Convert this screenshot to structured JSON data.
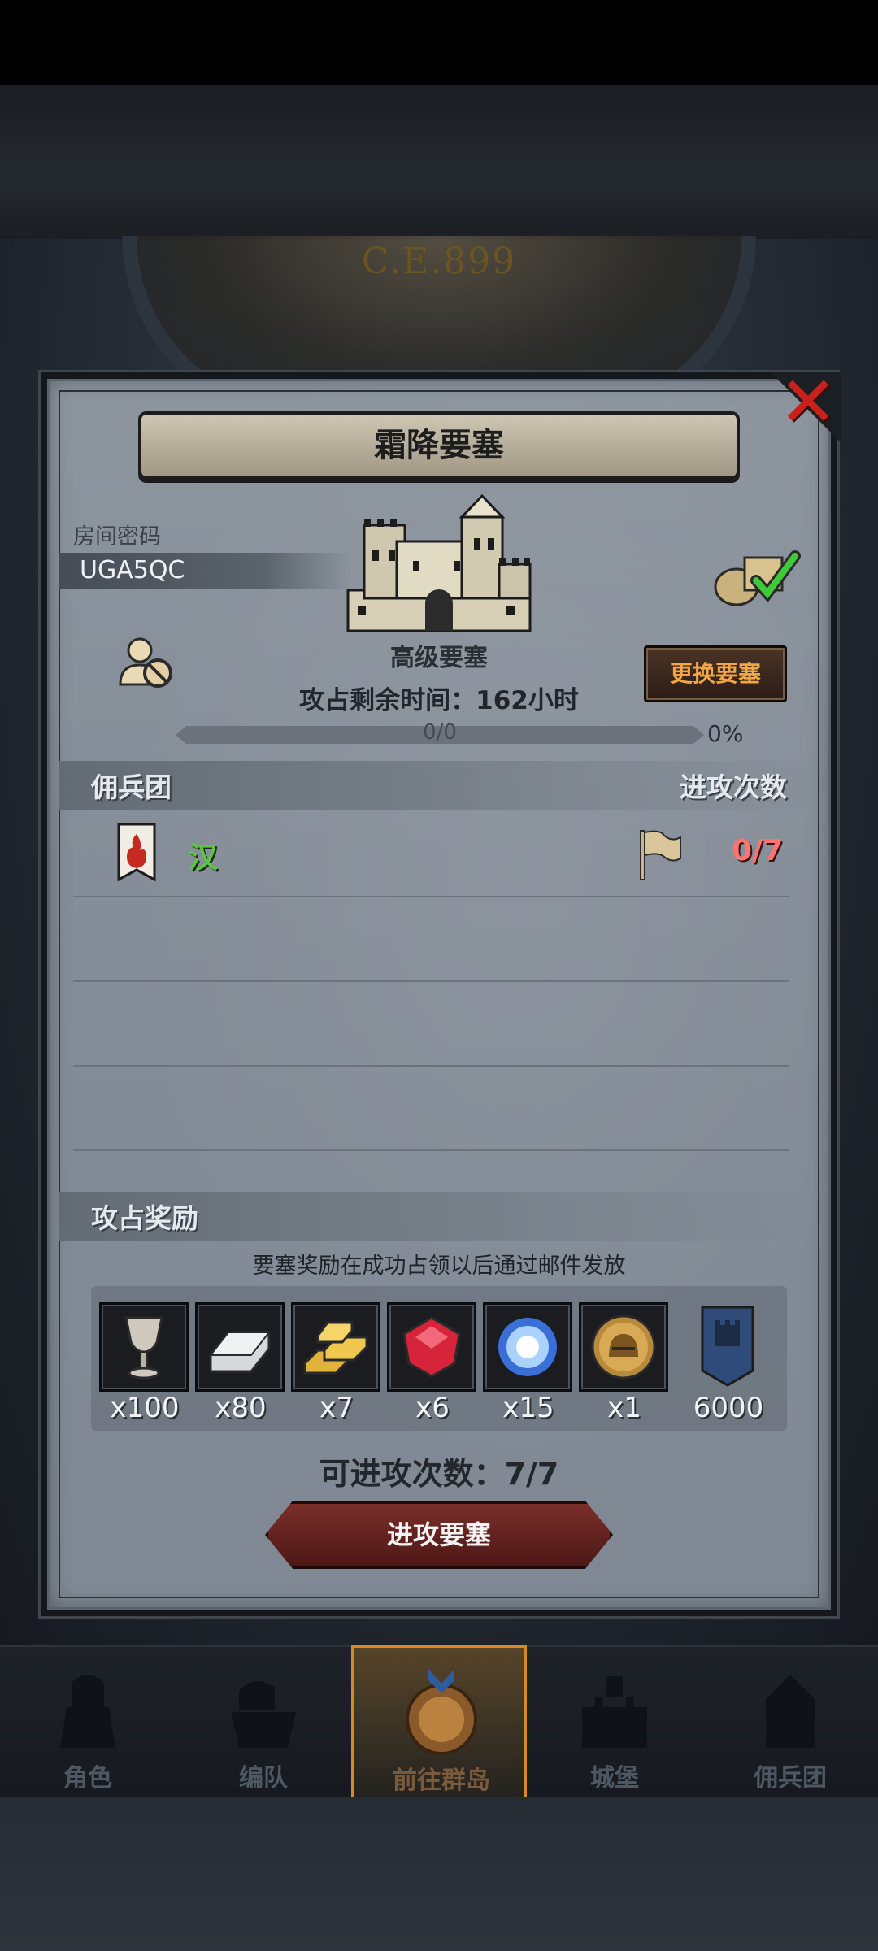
{
  "world": {
    "era_label": "C.E.899"
  },
  "dialog": {
    "title": "霜降要塞",
    "close_icon": "close-x-icon",
    "room": {
      "label": "房间密码",
      "code": "UGA5QC"
    },
    "fortress_type": "高级要塞",
    "change_button": "更换要塞",
    "time_left": "攻占剩余时间：162小时",
    "progress": {
      "text": "0/0",
      "percent_label": "0%",
      "value": 0
    },
    "mercenary_section": {
      "left": "佣兵团",
      "right": "进攻次数"
    },
    "mercenaries": [
      {
        "name": "汉",
        "attacks": "0/7",
        "banner_icon": "red-flame-banner-icon",
        "flag_icon": "flag-icon"
      }
    ],
    "rewards_section": {
      "title": "攻占奖励",
      "note": "要塞奖励在成功占领以后通过邮件发放"
    },
    "rewards": [
      {
        "icon": "silver-goblet-icon",
        "qty": "x100"
      },
      {
        "icon": "iron-ingot-icon",
        "qty": "x80"
      },
      {
        "icon": "gold-bars-icon",
        "qty": "x7"
      },
      {
        "icon": "ruby-gem-icon",
        "qty": "x6"
      },
      {
        "icon": "blue-crystal-icon",
        "qty": "x15"
      },
      {
        "icon": "helmet-medal-icon",
        "qty": "x1"
      },
      {
        "icon": "castle-shield-icon",
        "qty": "6000"
      }
    ],
    "attempts": "可进攻次数：7/7",
    "attack_button": "进攻要塞"
  },
  "nav": [
    {
      "label": "角色",
      "icon": "knight-icon"
    },
    {
      "label": "编队",
      "icon": "formation-icon"
    },
    {
      "label": "前往群岛",
      "icon": "islands-compass-icon",
      "active": true
    },
    {
      "label": "城堡",
      "icon": "castle-icon"
    },
    {
      "label": "佣兵团",
      "icon": "mercenary-icon"
    }
  ],
  "colors": {
    "panel": "#858d98",
    "accent_orange": "#f3a644",
    "merc_name_green": "#5ac83f",
    "attack_count_red": "#ff7373",
    "close_red": "#c8211b"
  }
}
